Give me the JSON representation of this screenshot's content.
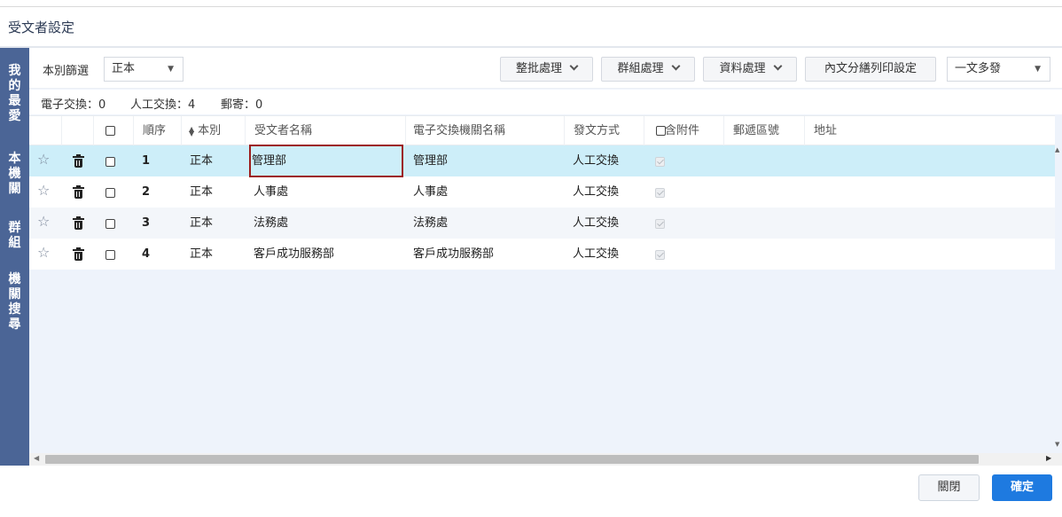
{
  "dialog": {
    "title": "受文者設定"
  },
  "sidebar": {
    "items": [
      {
        "label": "我的最愛",
        "chars": [
          "我",
          "的",
          "最",
          "愛"
        ]
      },
      {
        "label": "本機關",
        "chars": [
          "本",
          "機",
          "關"
        ]
      },
      {
        "label": "群組",
        "chars": [
          "群",
          "組"
        ]
      },
      {
        "label": "機關搜尋",
        "chars": [
          "機",
          "關",
          "搜",
          "尋"
        ]
      }
    ]
  },
  "filter": {
    "label": "本別篩選",
    "selected": "正本",
    "buttons": {
      "batch": "整批處理",
      "group": "群組處理",
      "data": "資料處理",
      "print": "內文分繕列印設定"
    },
    "dispatch_selected": "一文多發"
  },
  "counts": {
    "electronic": "電子交換：0",
    "manual": "人工交換：4",
    "mail": "郵寄：0"
  },
  "table": {
    "headers": {
      "order": "順序",
      "copy_type": "本別",
      "recipient": "受文者名稱",
      "agency": "電子交換機關名稱",
      "method": "發文方式",
      "attachment": "含附件",
      "postal": "郵遞區號",
      "address": "地址"
    },
    "rows": [
      {
        "order": "1",
        "copy_type": "正本",
        "recipient": "管理部",
        "agency": "管理部",
        "method": "人工交換"
      },
      {
        "order": "2",
        "copy_type": "正本",
        "recipient": "人事處",
        "agency": "人事處",
        "method": "人工交換"
      },
      {
        "order": "3",
        "copy_type": "正本",
        "recipient": "法務處",
        "agency": "法務處",
        "method": "人工交換"
      },
      {
        "order": "4",
        "copy_type": "正本",
        "recipient": "客戶成功服務部",
        "agency": "客戶成功服務部",
        "method": "人工交換"
      }
    ]
  },
  "footer": {
    "close": "關閉",
    "confirm": "確定"
  }
}
